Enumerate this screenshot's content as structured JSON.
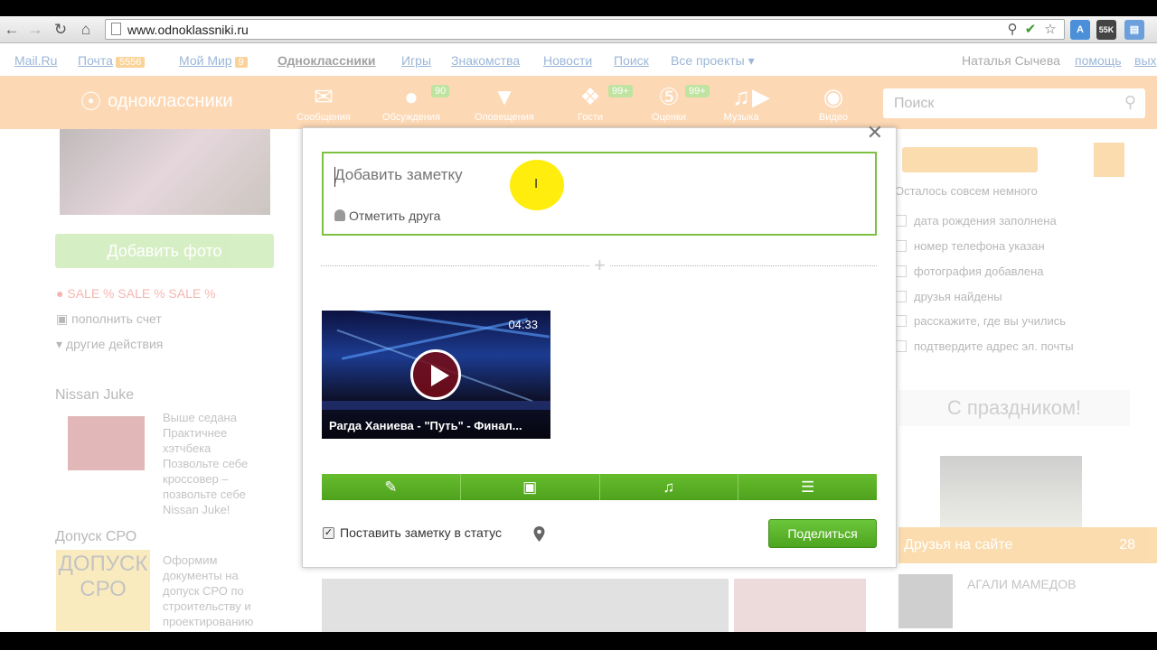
{
  "browser": {
    "url": "www.odnoklassniki.ru",
    "ext_badge": "55K"
  },
  "topnav": {
    "links": [
      "Mail.Ru",
      "Почта",
      "Мой Мир",
      "Одноклассники",
      "Игры",
      "Знакомства",
      "Новости",
      "Поиск",
      "Все проекты"
    ],
    "mail_count": "5556",
    "myworld_count": "9",
    "user_name": "Наталья Сычева",
    "help": "помощь",
    "exit": "вых"
  },
  "okbar": {
    "logo_text": "одноклассники",
    "items": [
      {
        "label": "Сообщения",
        "badge": ""
      },
      {
        "label": "Обсуждения",
        "badge": "90"
      },
      {
        "label": "Оповещения",
        "badge": ""
      },
      {
        "label": "Гости",
        "badge": "99+"
      },
      {
        "label": "Оценки",
        "badge": "99+"
      },
      {
        "label": "Музыка",
        "badge": ""
      },
      {
        "label": "Видео",
        "badge": ""
      }
    ],
    "search_placeholder": "Поиск"
  },
  "left": {
    "add_photo": "Добавить фото",
    "sale": "SALE % SALE % SALE %",
    "topup": "пополнить счет",
    "other_actions": "другие действия",
    "ad1_title": "Nissan Juke",
    "ad1_text": "Выше седана Практичнее хэтчбека Позвольте себе кроссовер – позвольте себе Nissan Juke!",
    "ad2_title": "Допуск СРО",
    "ad2_img_text": "ДОПУСК СРО",
    "ad2_text": "Оформим документы на допуск СРО по строительству и проектированию"
  },
  "right": {
    "almost": "Осталось совсем немного",
    "steps": [
      "дата рождения заполнена",
      "номер телефона указан",
      "фотография добавлена",
      "друзья найдены",
      "расскажите, где вы учились",
      "подтвердите адрес эл. почты"
    ],
    "holiday": "С праздником!",
    "friends_online": "Друзья на сайте",
    "friends_count": "28",
    "friend_name": "АГАЛИ МАМЕДОВ"
  },
  "modal": {
    "placeholder": "Добавить заметку",
    "tag_friend": "Отметить друга",
    "video_duration": "04:33",
    "video_title": "Рагда Ханиева - \"Путь\" - Финал...",
    "toolbar_icons": [
      "pencil-icon",
      "camera-icon",
      "music-icon",
      "text-icon"
    ],
    "status_label": "Поставить заметку в статус",
    "status_checked": true,
    "share_label": "Поделиться"
  },
  "colors": {
    "ok_orange": "#f59e1c",
    "ok_green": "#5bb025",
    "cursor_highlight": "#ffec00"
  }
}
